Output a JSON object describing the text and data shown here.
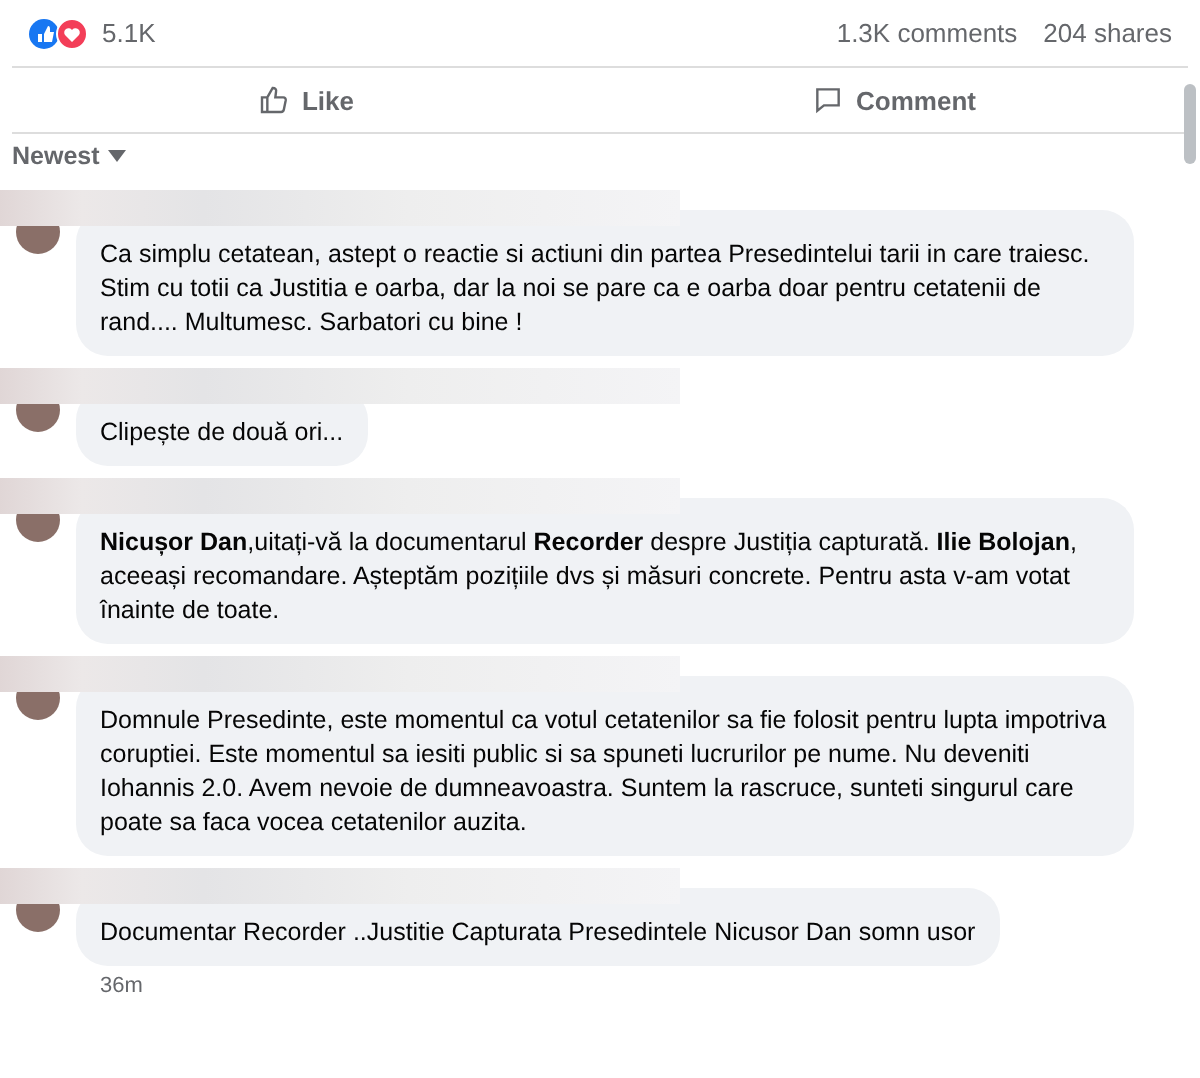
{
  "reactions": {
    "count": "5.1K"
  },
  "stats": {
    "comments": "1.3K comments",
    "shares": "204 shares"
  },
  "actions": [
    {
      "kind": "like",
      "label": "Like"
    },
    {
      "kind": "comment",
      "label": "Comment"
    }
  ],
  "sort": {
    "label": "Newest"
  },
  "comments": [
    {
      "text": "Ca simplu cetatean, astept o reactie si actiuni din partea Presedintelui tarii in care traiesc. Stim cu totii ca Justitia e oarba, dar la noi se pare ca e oarba doar pentru cetatenii de rand.... Multumesc. Sarbatori cu bine !"
    },
    {
      "text": "Clipește de două ori..."
    },
    {
      "text": "**Nicușor Dan**,uitați-vă la documentarul **Recorder** despre Justiția capturată. **Ilie Bolojan**, aceeași recomandare. Așteptăm pozițiile dvs și măsuri concrete. Pentru asta v-am votat înainte de toate."
    },
    {
      "text": "Domnule Presedinte, este momentul ca votul cetatenilor sa fie folosit pentru lupta impotriva coruptiei. Este momentul sa iesiti public si sa spuneti lucrurilor pe nume. Nu deveniti Iohannis 2.0. Avem nevoie de dumneavoastra. Suntem la rascruce, sunteti singurul care poate sa faca vocea cetatenilor auzita."
    },
    {
      "text": "Documentar Recorder ..Justitie Capturata Presedintele Nicusor Dan somn usor",
      "time": "36m"
    }
  ]
}
